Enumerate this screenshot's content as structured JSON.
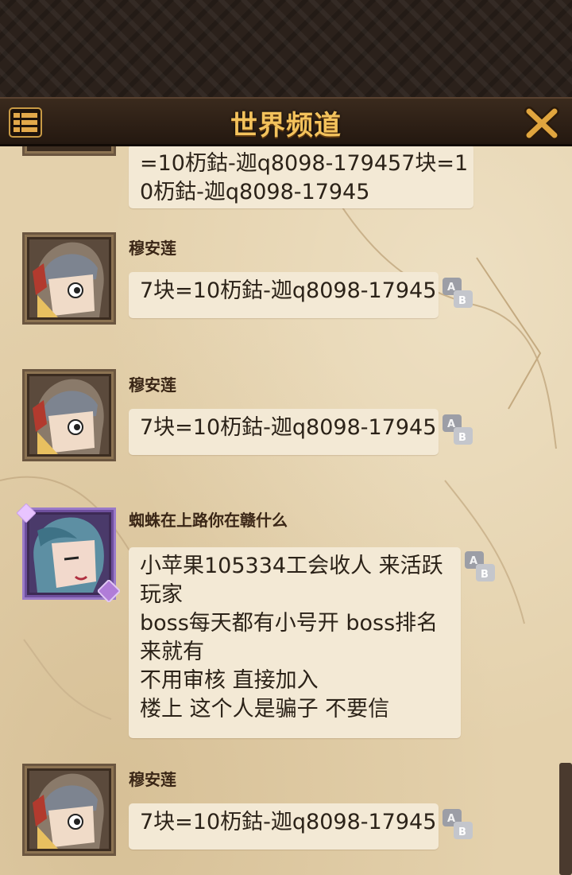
{
  "header": {
    "title": "世界频道",
    "menu_icon": "menu-list-icon",
    "close_icon": "close-x-icon"
  },
  "colors": {
    "title": "#f3c25c",
    "parchment": "#e4d1ac",
    "bubble": "#f3e9d5",
    "name": "#3a2616"
  },
  "messages": [
    {
      "name": "",
      "lines": [
        "=10杤鈷-迦q8098-179457块=1",
        "0杤鈷-迦q8098-17945"
      ],
      "avatar": "partial-avatar"
    },
    {
      "name": "穆安莲",
      "lines": [
        "7块=10杤鈷-迦q8098-17945"
      ],
      "avatar": "knight-girl-avatar"
    },
    {
      "name": "穆安莲",
      "lines": [
        "7块=10杤鈷-迦q8098-17945"
      ],
      "avatar": "knight-girl-avatar"
    },
    {
      "name": "蜘蛛在上路你在赣什么",
      "lines": [
        "小苹果105334工会收人 来活跃",
        "玩家",
        "boss每天都有小号开 boss排名",
        "来就有",
        "不用审核 直接加入",
        "楼上 这个人是骗子 不要信"
      ],
      "avatar": "blue-hair-avatar"
    },
    {
      "name": "穆安莲",
      "lines": [
        "7块=10杤鈷-迦q8098-17945"
      ],
      "avatar": "knight-girl-avatar"
    }
  ],
  "translate_icon": "translate-ab-icon"
}
